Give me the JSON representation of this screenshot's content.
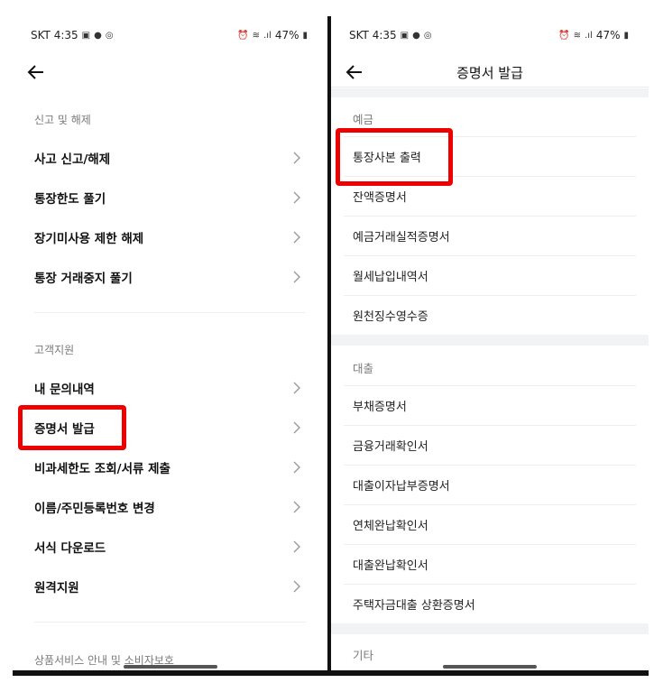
{
  "status_bar": {
    "carrier_time": "SKT 4:35",
    "battery": "47%"
  },
  "left": {
    "section1_label": "신고 및 해제",
    "section1_items": [
      {
        "label": "사고 신고/해제"
      },
      {
        "label": "통장한도 풀기"
      },
      {
        "label": "장기미사용 제한 해제"
      },
      {
        "label": "통장 거래중지 풀기"
      }
    ],
    "section2_label": "고객지원",
    "section2_items": [
      {
        "label": "내 문의내역"
      },
      {
        "label": "증명서 발급"
      },
      {
        "label": "비과세한도 조회/서류 제출"
      },
      {
        "label": "이름/주민등록번호 변경"
      },
      {
        "label": "서식 다운로드"
      },
      {
        "label": "원격지원"
      }
    ],
    "section3_label": "상품서비스 안내 및 소비자보호"
  },
  "right": {
    "title": "증명서 발급",
    "deposit_label": "예금",
    "deposit_items": [
      {
        "label": "통장사본 출력"
      },
      {
        "label": "잔액증명서"
      },
      {
        "label": "예금거래실적증명서"
      },
      {
        "label": "월세납입내역서"
      },
      {
        "label": "원천징수영수증"
      }
    ],
    "loan_label": "대출",
    "loan_items": [
      {
        "label": "부채증명서"
      },
      {
        "label": "금융거래확인서"
      },
      {
        "label": "대출이자납부증명서"
      },
      {
        "label": "연체완납확인서"
      },
      {
        "label": "대출완납확인서"
      },
      {
        "label": "주택자금대출 상환증명서"
      }
    ],
    "other_label": "기타"
  },
  "colors": {
    "highlight": "#ee0000",
    "section_band": "#f2f3f5"
  },
  "icons": {
    "back": "arrow-left-icon",
    "chevron": "chevron-right-icon"
  }
}
